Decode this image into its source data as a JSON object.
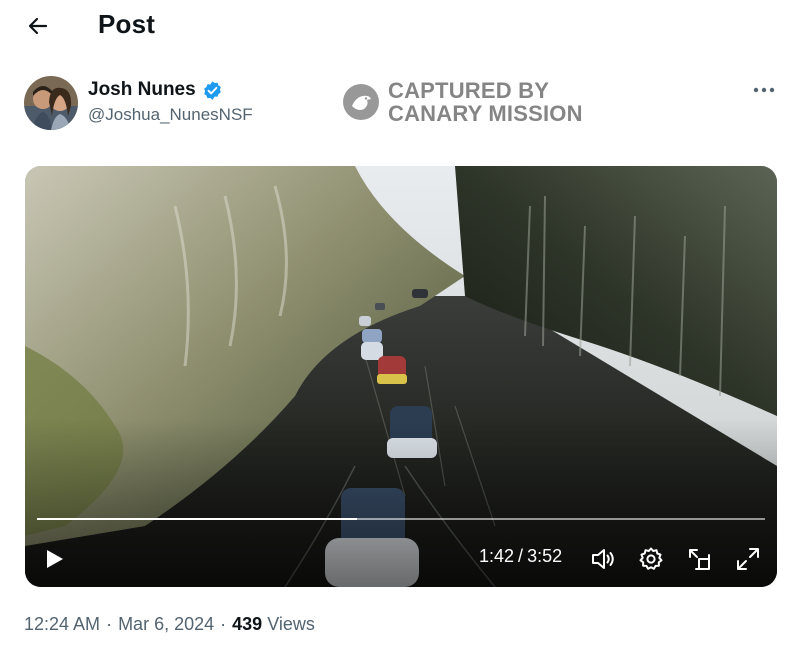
{
  "header": {
    "title": "Post",
    "back_icon": "arrow-left-icon"
  },
  "author": {
    "display_name": "Josh Nunes",
    "handle": "@Joshua_NunesNSF",
    "verified_color": "#1d9bf0",
    "more_icon": "more-horizontal-icon"
  },
  "watermark": {
    "line1": "CAPTURED BY",
    "line2": "CANARY MISSION"
  },
  "video": {
    "current_time": "1:42",
    "separator": "/",
    "duration": "3:52",
    "progress_fraction": 0.44,
    "icons": [
      "play-icon",
      "volume-icon",
      "settings-gear-icon",
      "pop-out-icon",
      "fullscreen-icon"
    ]
  },
  "meta": {
    "time": "12:24 AM",
    "dot1": "·",
    "date": "Mar 6, 2024",
    "dot2": "·",
    "views_count": "439",
    "views_label": "Views"
  }
}
